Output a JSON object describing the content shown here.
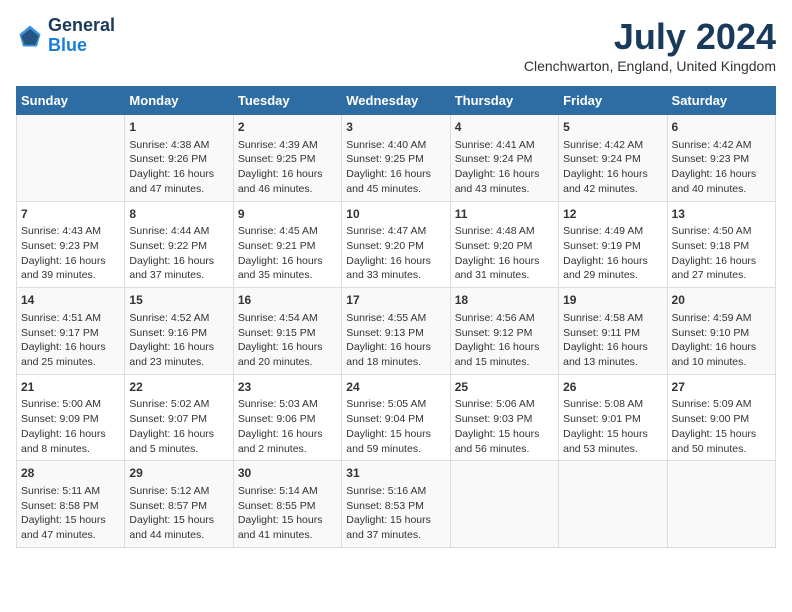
{
  "logo": {
    "line1": "General",
    "line2": "Blue"
  },
  "title": "July 2024",
  "location": "Clenchwarton, England, United Kingdom",
  "days_of_week": [
    "Sunday",
    "Monday",
    "Tuesday",
    "Wednesday",
    "Thursday",
    "Friday",
    "Saturday"
  ],
  "weeks": [
    [
      {
        "day": "",
        "info": ""
      },
      {
        "day": "1",
        "info": "Sunrise: 4:38 AM\nSunset: 9:26 PM\nDaylight: 16 hours and 47 minutes."
      },
      {
        "day": "2",
        "info": "Sunrise: 4:39 AM\nSunset: 9:25 PM\nDaylight: 16 hours and 46 minutes."
      },
      {
        "day": "3",
        "info": "Sunrise: 4:40 AM\nSunset: 9:25 PM\nDaylight: 16 hours and 45 minutes."
      },
      {
        "day": "4",
        "info": "Sunrise: 4:41 AM\nSunset: 9:24 PM\nDaylight: 16 hours and 43 minutes."
      },
      {
        "day": "5",
        "info": "Sunrise: 4:42 AM\nSunset: 9:24 PM\nDaylight: 16 hours and 42 minutes."
      },
      {
        "day": "6",
        "info": "Sunrise: 4:42 AM\nSunset: 9:23 PM\nDaylight: 16 hours and 40 minutes."
      }
    ],
    [
      {
        "day": "7",
        "info": "Sunrise: 4:43 AM\nSunset: 9:23 PM\nDaylight: 16 hours and 39 minutes."
      },
      {
        "day": "8",
        "info": "Sunrise: 4:44 AM\nSunset: 9:22 PM\nDaylight: 16 hours and 37 minutes."
      },
      {
        "day": "9",
        "info": "Sunrise: 4:45 AM\nSunset: 9:21 PM\nDaylight: 16 hours and 35 minutes."
      },
      {
        "day": "10",
        "info": "Sunrise: 4:47 AM\nSunset: 9:20 PM\nDaylight: 16 hours and 33 minutes."
      },
      {
        "day": "11",
        "info": "Sunrise: 4:48 AM\nSunset: 9:20 PM\nDaylight: 16 hours and 31 minutes."
      },
      {
        "day": "12",
        "info": "Sunrise: 4:49 AM\nSunset: 9:19 PM\nDaylight: 16 hours and 29 minutes."
      },
      {
        "day": "13",
        "info": "Sunrise: 4:50 AM\nSunset: 9:18 PM\nDaylight: 16 hours and 27 minutes."
      }
    ],
    [
      {
        "day": "14",
        "info": "Sunrise: 4:51 AM\nSunset: 9:17 PM\nDaylight: 16 hours and 25 minutes."
      },
      {
        "day": "15",
        "info": "Sunrise: 4:52 AM\nSunset: 9:16 PM\nDaylight: 16 hours and 23 minutes."
      },
      {
        "day": "16",
        "info": "Sunrise: 4:54 AM\nSunset: 9:15 PM\nDaylight: 16 hours and 20 minutes."
      },
      {
        "day": "17",
        "info": "Sunrise: 4:55 AM\nSunset: 9:13 PM\nDaylight: 16 hours and 18 minutes."
      },
      {
        "day": "18",
        "info": "Sunrise: 4:56 AM\nSunset: 9:12 PM\nDaylight: 16 hours and 15 minutes."
      },
      {
        "day": "19",
        "info": "Sunrise: 4:58 AM\nSunset: 9:11 PM\nDaylight: 16 hours and 13 minutes."
      },
      {
        "day": "20",
        "info": "Sunrise: 4:59 AM\nSunset: 9:10 PM\nDaylight: 16 hours and 10 minutes."
      }
    ],
    [
      {
        "day": "21",
        "info": "Sunrise: 5:00 AM\nSunset: 9:09 PM\nDaylight: 16 hours and 8 minutes."
      },
      {
        "day": "22",
        "info": "Sunrise: 5:02 AM\nSunset: 9:07 PM\nDaylight: 16 hours and 5 minutes."
      },
      {
        "day": "23",
        "info": "Sunrise: 5:03 AM\nSunset: 9:06 PM\nDaylight: 16 hours and 2 minutes."
      },
      {
        "day": "24",
        "info": "Sunrise: 5:05 AM\nSunset: 9:04 PM\nDaylight: 15 hours and 59 minutes."
      },
      {
        "day": "25",
        "info": "Sunrise: 5:06 AM\nSunset: 9:03 PM\nDaylight: 15 hours and 56 minutes."
      },
      {
        "day": "26",
        "info": "Sunrise: 5:08 AM\nSunset: 9:01 PM\nDaylight: 15 hours and 53 minutes."
      },
      {
        "day": "27",
        "info": "Sunrise: 5:09 AM\nSunset: 9:00 PM\nDaylight: 15 hours and 50 minutes."
      }
    ],
    [
      {
        "day": "28",
        "info": "Sunrise: 5:11 AM\nSunset: 8:58 PM\nDaylight: 15 hours and 47 minutes."
      },
      {
        "day": "29",
        "info": "Sunrise: 5:12 AM\nSunset: 8:57 PM\nDaylight: 15 hours and 44 minutes."
      },
      {
        "day": "30",
        "info": "Sunrise: 5:14 AM\nSunset: 8:55 PM\nDaylight: 15 hours and 41 minutes."
      },
      {
        "day": "31",
        "info": "Sunrise: 5:16 AM\nSunset: 8:53 PM\nDaylight: 15 hours and 37 minutes."
      },
      {
        "day": "",
        "info": ""
      },
      {
        "day": "",
        "info": ""
      },
      {
        "day": "",
        "info": ""
      }
    ]
  ]
}
